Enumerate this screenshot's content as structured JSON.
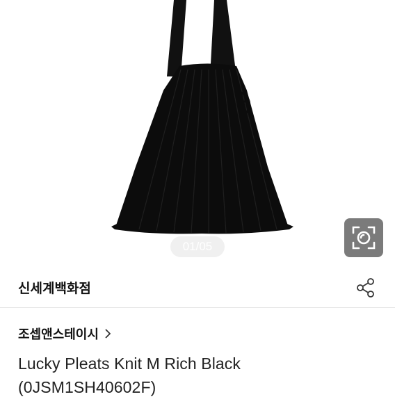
{
  "gallery": {
    "image_alt": "black pleated knit tote bag",
    "indicator": "01/05",
    "lens_icon": "camera-lens-search-icon"
  },
  "brand": {
    "name": "신세계백화점",
    "share_icon": "share-icon"
  },
  "product": {
    "store_name": "조셉앤스테이시",
    "store_chevron_icon": "chevron-right-icon",
    "title": "Lucky Pleats Knit M Rich Black (0JSM1SH40602F)"
  }
}
